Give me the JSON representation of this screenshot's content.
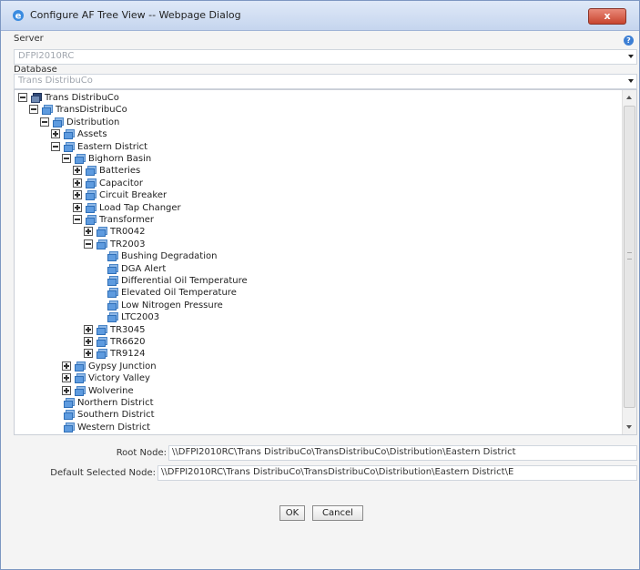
{
  "window": {
    "title": "Configure AF Tree View -- Webpage Dialog",
    "close_label": "x",
    "help_label": "?"
  },
  "server": {
    "label": "Server",
    "value": "DFPI2010RC"
  },
  "database": {
    "label": "Database",
    "value": "Trans DistribuCo"
  },
  "tree": {
    "nodes": [
      {
        "label": "Trans DistribuCo",
        "level": 0,
        "expander": "minus",
        "icon": "server-icon"
      },
      {
        "label": "TransDistribuCo",
        "level": 1,
        "expander": "minus",
        "icon": "element-icon"
      },
      {
        "label": "Distribution",
        "level": 2,
        "expander": "minus",
        "icon": "element-icon"
      },
      {
        "label": "Assets",
        "level": 3,
        "expander": "plus",
        "icon": "element-icon"
      },
      {
        "label": "Eastern District",
        "level": 3,
        "expander": "minus",
        "icon": "element-icon"
      },
      {
        "label": "Bighorn Basin",
        "level": 4,
        "expander": "minus",
        "icon": "element-icon"
      },
      {
        "label": "Batteries",
        "level": 5,
        "expander": "plus",
        "icon": "element-icon"
      },
      {
        "label": "Capacitor",
        "level": 5,
        "expander": "plus",
        "icon": "element-icon"
      },
      {
        "label": "Circuit Breaker",
        "level": 5,
        "expander": "plus",
        "icon": "element-icon"
      },
      {
        "label": "Load Tap Changer",
        "level": 5,
        "expander": "plus",
        "icon": "element-icon"
      },
      {
        "label": "Transformer",
        "level": 5,
        "expander": "minus",
        "icon": "element-icon"
      },
      {
        "label": "TR0042",
        "level": 6,
        "expander": "plus",
        "icon": "element-icon"
      },
      {
        "label": "TR2003",
        "level": 6,
        "expander": "minus",
        "icon": "element-icon"
      },
      {
        "label": "Bushing Degradation",
        "level": 7,
        "expander": "none",
        "icon": "element-icon"
      },
      {
        "label": "DGA Alert",
        "level": 7,
        "expander": "none",
        "icon": "element-icon"
      },
      {
        "label": "Differential Oil Temperature",
        "level": 7,
        "expander": "none",
        "icon": "element-icon"
      },
      {
        "label": "Elevated Oil Temperature",
        "level": 7,
        "expander": "none",
        "icon": "element-icon"
      },
      {
        "label": "Low Nitrogen Pressure",
        "level": 7,
        "expander": "none",
        "icon": "element-icon"
      },
      {
        "label": "LTC2003",
        "level": 7,
        "expander": "none",
        "icon": "element-icon"
      },
      {
        "label": "TR3045",
        "level": 6,
        "expander": "plus",
        "icon": "element-icon"
      },
      {
        "label": "TR6620",
        "level": 6,
        "expander": "plus",
        "icon": "element-icon"
      },
      {
        "label": "TR9124",
        "level": 6,
        "expander": "plus",
        "icon": "element-icon"
      },
      {
        "label": "Gypsy Junction",
        "level": 4,
        "expander": "plus",
        "icon": "element-icon"
      },
      {
        "label": "Victory Valley",
        "level": 4,
        "expander": "plus",
        "icon": "element-icon"
      },
      {
        "label": "Wolverine",
        "level": 4,
        "expander": "plus",
        "icon": "element-icon"
      },
      {
        "label": "Northern District",
        "level": 3,
        "expander": "none",
        "icon": "element-icon"
      },
      {
        "label": "Southern District",
        "level": 3,
        "expander": "none",
        "icon": "element-icon"
      },
      {
        "label": "Western District",
        "level": 3,
        "expander": "none",
        "icon": "element-icon"
      }
    ]
  },
  "root_node": {
    "label": "Root Node:",
    "value": "\\\\DFPI2010RC\\Trans DistribuCo\\TransDistribuCo\\Distribution\\Eastern District"
  },
  "default_selected_node": {
    "label": "Default Selected Node:",
    "value": "\\\\DFPI2010RC\\Trans DistribuCo\\TransDistribuCo\\Distribution\\Eastern District\\E"
  },
  "buttons": {
    "ok": "OK",
    "cancel": "Cancel"
  }
}
